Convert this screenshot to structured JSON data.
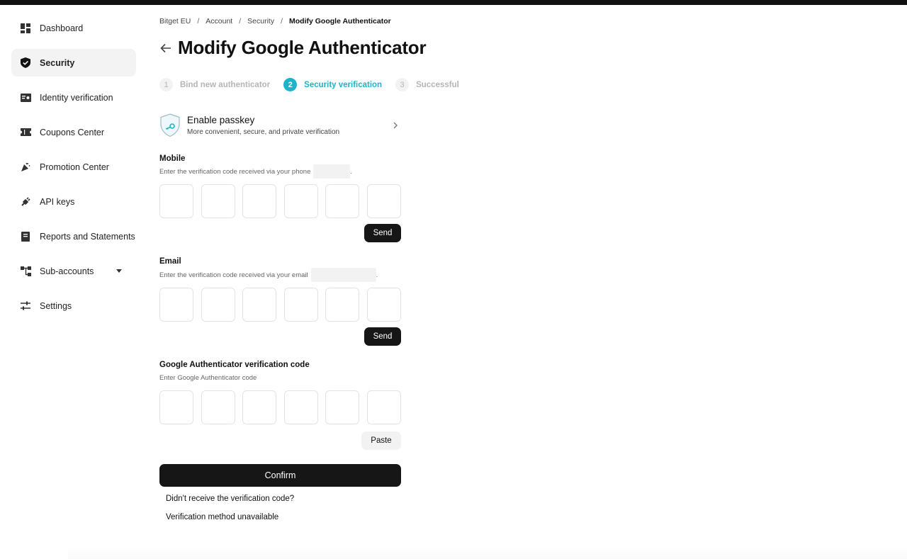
{
  "sidebar": {
    "items": [
      {
        "label": "Dashboard",
        "icon": "dashboard-icon",
        "active": false
      },
      {
        "label": "Security",
        "icon": "shield-check-icon",
        "active": true
      },
      {
        "label": "Identity verification",
        "icon": "id-card-icon",
        "active": false
      },
      {
        "label": "Coupons Center",
        "icon": "ticket-icon",
        "active": false
      },
      {
        "label": "Promotion Center",
        "icon": "party-popper-icon",
        "active": false
      },
      {
        "label": "API keys",
        "icon": "plug-icon",
        "active": false
      },
      {
        "label": "Reports and Statements",
        "icon": "book-icon",
        "active": false
      },
      {
        "label": "Sub-accounts",
        "icon": "org-chart-icon",
        "active": false
      },
      {
        "label": "Settings",
        "icon": "sliders-icon",
        "active": false
      }
    ]
  },
  "breadcrumb": {
    "items": [
      "Bitget EU",
      "Account",
      "Security"
    ],
    "current": "Modify Google Authenticator",
    "separator": "/"
  },
  "page": {
    "title": "Modify Google Authenticator"
  },
  "steps": [
    {
      "num": "1",
      "label": "Bind new authenticator"
    },
    {
      "num": "2",
      "label": "Security verification"
    },
    {
      "num": "3",
      "label": "Successful"
    }
  ],
  "passkey": {
    "title": "Enable passkey",
    "subtitle": "More convenient, secure, and private verification"
  },
  "mobile": {
    "label": "Mobile",
    "hint": "Enter the verification code received via your phone",
    "hint_end": ".",
    "send_label": "Send"
  },
  "email": {
    "label": "Email",
    "hint": "Enter the verification code received via your email",
    "hint_end": ".",
    "send_label": "Send"
  },
  "google": {
    "label": "Google Authenticator verification code",
    "hint": "Enter Google Authenticator code",
    "paste_label": "Paste"
  },
  "confirm_label": "Confirm",
  "links": {
    "no_code": "Didn't receive the verification code?",
    "unavailable": "Verification method unavailable"
  },
  "colors": {
    "accent": "#1fb3c9",
    "button_dark": "#161616",
    "active_nav_bg": "#f3f3f3"
  }
}
